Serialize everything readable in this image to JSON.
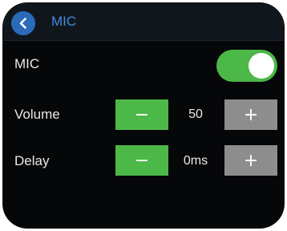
{
  "header": {
    "title": "MIC",
    "back_icon": "chevron-left-icon"
  },
  "mic": {
    "label": "MIC",
    "enabled": true,
    "toggle_color": "#4cb848"
  },
  "volume": {
    "label": "Volume",
    "decrement_label": "−",
    "value": "50",
    "increment_label": "+"
  },
  "delay": {
    "label": "Delay",
    "decrement_label": "−",
    "value": "0ms",
    "increment_label": "+"
  },
  "colors": {
    "accent": "#3f8ce0",
    "back_button": "#2a6ab8",
    "active_button": "#4cb848",
    "inactive_button": "#8d8d8d",
    "background": "#050709"
  }
}
